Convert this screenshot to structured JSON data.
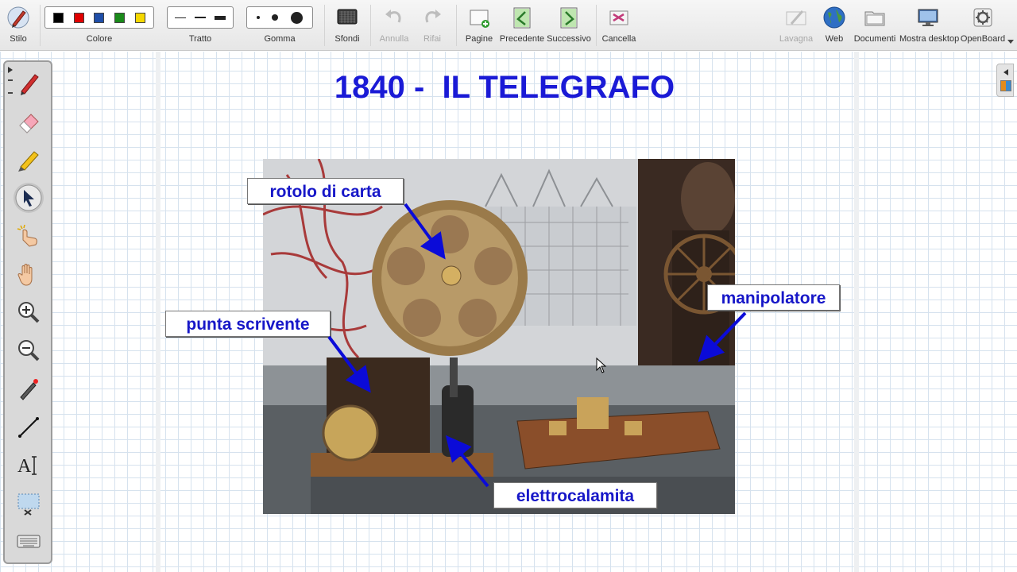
{
  "toolbar": {
    "stylus": "Stilo",
    "color": "Colore",
    "stroke": "Tratto",
    "eraser": "Gomma",
    "backgrounds": "Sfondi",
    "undo": "Annulla",
    "redo": "Rifai",
    "pages": "Pagine",
    "previous": "Precedente",
    "next": "Successivo",
    "clear": "Cancella",
    "board": "Lavagna",
    "web": "Web",
    "documents": "Documenti",
    "show_desktop": "Mostra desktop",
    "openboard": "OpenBoard",
    "colors": [
      "#000000",
      "#e00000",
      "#1f4ea8",
      "#1a8a1a",
      "#f5d800"
    ]
  },
  "palette": {
    "tools": [
      "pen-icon",
      "eraser-icon",
      "marker-icon",
      "selector-icon",
      "play-icon",
      "hand-icon",
      "zoom-in-icon",
      "zoom-out-icon",
      "laser-pointer-icon",
      "line-icon",
      "text-icon",
      "capture-icon",
      "keyboard-icon"
    ]
  },
  "board": {
    "title": "1840 -  IL TELEGRAFO",
    "callouts": {
      "paper_roll": "rotolo di carta",
      "writing_tip": "punta scrivente",
      "manipulator": "manipolatore",
      "electromagnet": "elettrocalamita"
    },
    "accent": "#1a1ad6"
  }
}
